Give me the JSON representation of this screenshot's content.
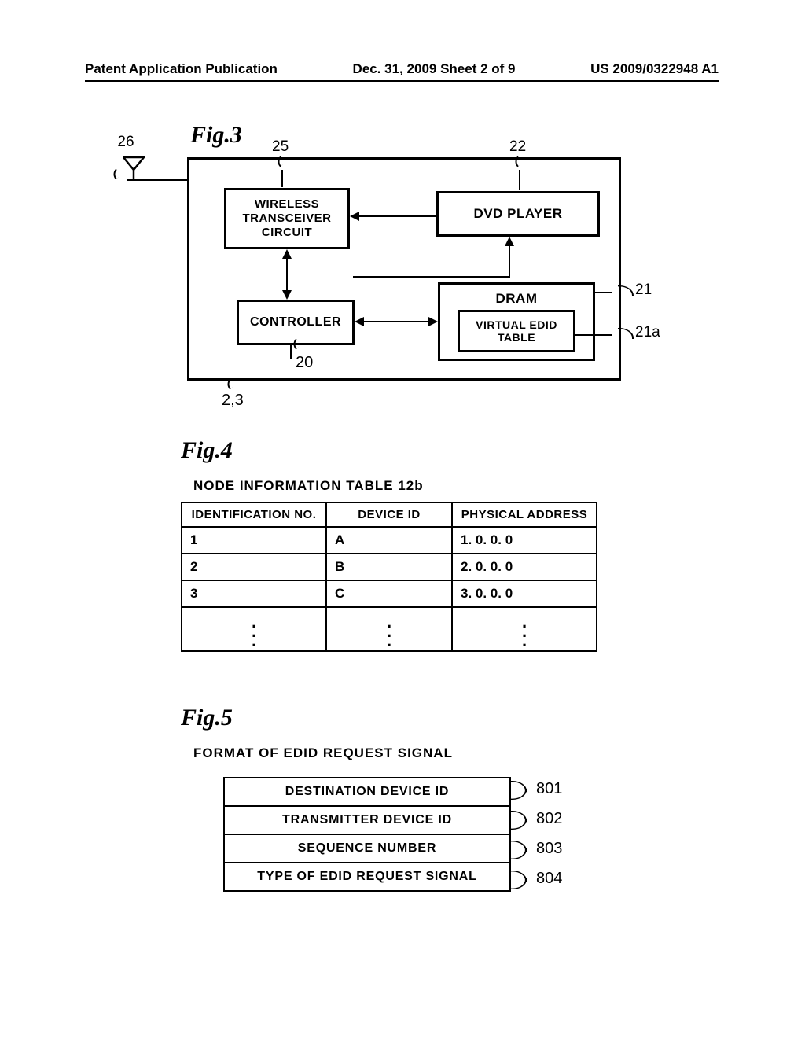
{
  "header": {
    "left": "Patent Application Publication",
    "center": "Dec. 31, 2009  Sheet 2 of 9",
    "right": "US 2009/0322948 A1"
  },
  "fig3": {
    "title": "Fig.3",
    "antenna_ref": "26",
    "blocks": {
      "wireless": "WIRELESS TRANSCEIVER CIRCUIT",
      "wireless_ref": "25",
      "dvd": "DVD PLAYER",
      "dvd_ref": "22",
      "controller": "CONTROLLER",
      "controller_ref": "20",
      "dram": "DRAM",
      "dram_ref": "21",
      "edid": "VIRTUAL EDID TABLE",
      "edid_ref": "21a"
    },
    "outer_ref": "2,3"
  },
  "fig4": {
    "title": "Fig.4",
    "caption": "NODE INFORMATION TABLE 12b",
    "columns": [
      "IDENTIFICATION NO.",
      "DEVICE ID",
      "PHYSICAL ADDRESS"
    ],
    "rows": [
      {
        "id": "1",
        "dev": "A",
        "addr": "1. 0. 0. 0"
      },
      {
        "id": "2",
        "dev": "B",
        "addr": "2. 0. 0. 0"
      },
      {
        "id": "3",
        "dev": "C",
        "addr": "3. 0. 0. 0"
      }
    ]
  },
  "fig5": {
    "title": "Fig.5",
    "caption": "FORMAT OF EDID REQUEST SIGNAL",
    "rows": [
      {
        "label": "DESTINATION DEVICE ID",
        "ref": "801"
      },
      {
        "label": "TRANSMITTER DEVICE ID",
        "ref": "802"
      },
      {
        "label": "SEQUENCE NUMBER",
        "ref": "803"
      },
      {
        "label": "TYPE OF EDID REQUEST SIGNAL",
        "ref": "804"
      }
    ]
  }
}
